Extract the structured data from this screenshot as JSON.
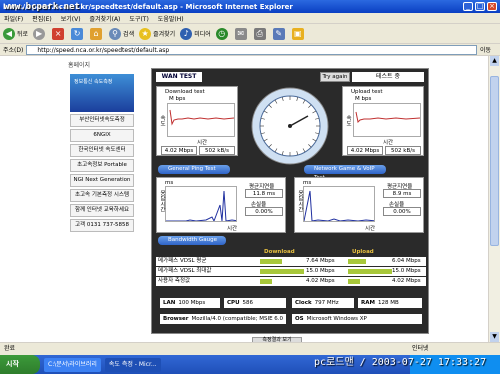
{
  "window": {
    "title": "http://speed.nca.or.kr/speedtest/default.asp - Microsoft Internet Explorer",
    "watermark_top": "www.bcpark.net"
  },
  "menu": {
    "items": [
      "파일(F)",
      "편집(E)",
      "보기(V)",
      "즐겨찾기(A)",
      "도구(T)",
      "도움말(H)"
    ]
  },
  "toolbar": {
    "back": "뒤로",
    "search": "검색",
    "favorites": "즐겨찾기",
    "media": "미디어"
  },
  "address": {
    "label": "주소(D)",
    "url": "http://speed.nca.or.kr/speedtest/default.asp",
    "go": "이동"
  },
  "sidebar": {
    "header": "홈페이지",
    "banner_text": "정보통신 속도측정",
    "items": [
      "부산인터넷속도측정",
      "6NGIX",
      "한국인터넷 속도센터",
      "초고속정보 Portable",
      "NGI Next Generation",
      "초고속 기본측정 시스템",
      "함께 인터넷 교육하세요",
      "고객 0131 737-5858"
    ]
  },
  "test": {
    "title": "WAN TEST",
    "try_again": "Try again",
    "test_label": "테스트 중",
    "download": {
      "title": "Download test",
      "unit": "M bps",
      "axis_y": "속도",
      "axis_x": "시간",
      "mbps": "4.02 Mbps",
      "kbs": "502 kB/s"
    },
    "upload": {
      "title": "Upload test",
      "unit": "M bps",
      "axis_y": "속도",
      "axis_x": "시간",
      "mbps": "4.02 Mbps",
      "kbs": "502 kB/s"
    },
    "general_ping": "General Ping Test",
    "voip_test": "Network Game & VoIP Test",
    "ping1": {
      "unit": "ms",
      "axis_y": "응답시간",
      "axis_x": "시간",
      "avg_label": "평균지연율",
      "avg_value": "11.8 ms",
      "loss_label": "손실율",
      "loss_value": "0.00%"
    },
    "ping2": {
      "unit": "ms",
      "axis_y": "응답시간",
      "axis_x": "시간",
      "avg_label": "평균지연율",
      "avg_value": "8.9 ms",
      "loss_label": "손실율",
      "loss_value": "0.00%"
    },
    "bandwidth_gauge": "Bandwidth Gauge",
    "rows": {
      "download_header": "Download",
      "upload_header": "Upload",
      "items": [
        {
          "label": "메가패스 VDSL 평균",
          "down": "7.64 Mbps",
          "up": "6.04 Mbps",
          "down_frac": 0.51,
          "up_frac": 0.4
        },
        {
          "label": "메가패스 VDSL 최대값",
          "down": "15.0 Mbps",
          "up": "15.0 Mbps",
          "down_frac": 1.0,
          "up_frac": 1.0
        },
        {
          "label": "사용자 측정값",
          "down": "4.02 Mbps",
          "up": "4.02 Mbps",
          "down_frac": 0.27,
          "up_frac": 0.27
        }
      ]
    },
    "sysinfo": {
      "lan_label": "LAN",
      "lan_value": "100 Mbps",
      "cpu_label": "CPU",
      "cpu_value": "586",
      "clock_label": "Clock",
      "clock_value": "797 MHz",
      "ram_label": "RAM",
      "ram_value": "128 MB",
      "browser_label": "Browser",
      "browser_value": "Mozilla/4.0 (compatible; MSIE 6.0",
      "os_label": "OS",
      "os_value": "Microsoft Windows XP"
    },
    "bottom_btn": "측정결과 보기"
  },
  "status": {
    "text": "완료",
    "zone": "인터넷"
  },
  "taskbar": {
    "start": "시작",
    "task": "속도 측정 - Micr...",
    "folder": "C:\\문서\\라이브러리"
  },
  "watermark": "pc로드맨 / 2003-07-27 17:33:27",
  "colors": {
    "accent": "#2f64c8",
    "bar": "#a8c83a",
    "panel": "#2a2a2a"
  }
}
